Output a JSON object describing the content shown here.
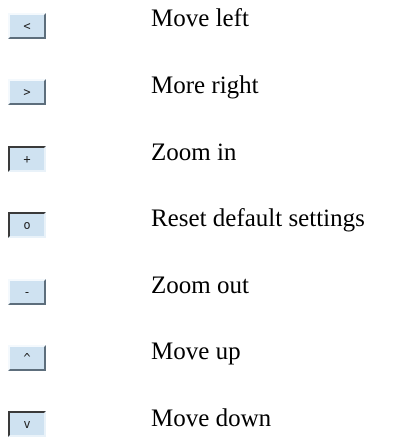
{
  "legend": {
    "items": [
      {
        "glyph": "<",
        "label": "Move left"
      },
      {
        "glyph": ">",
        "label": "More right"
      },
      {
        "glyph": "+",
        "label": "Zoom in"
      },
      {
        "glyph": "o",
        "label": "Reset default settings"
      },
      {
        "glyph": "-",
        "label": "Zoom out"
      },
      {
        "glyph": "^",
        "label": "Move up"
      },
      {
        "glyph": "v",
        "label": "Move down"
      }
    ]
  },
  "colors": {
    "button_face": "#cfe2f1",
    "button_shadow": "#5d6e7c",
    "button_highlight": "#f4f9fd",
    "text": "#000000"
  }
}
